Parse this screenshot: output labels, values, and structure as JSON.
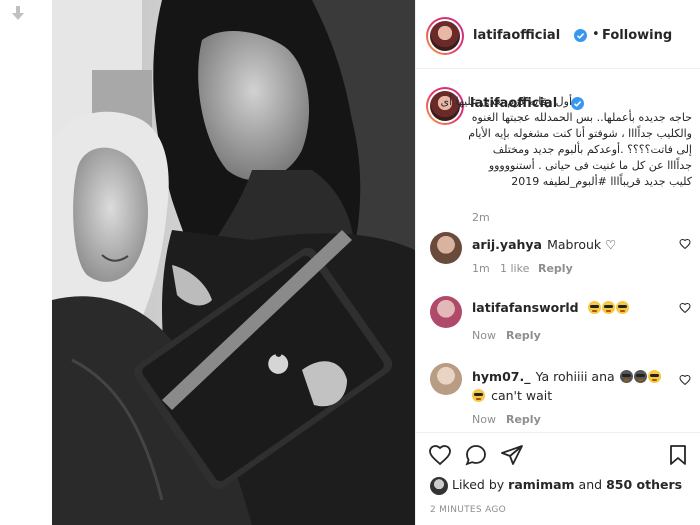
{
  "header": {
    "username": "latifaofficial",
    "separator": "•",
    "follow_status": "Following"
  },
  "caption": {
    "username": "latifaofficial",
    "lines": [
      "أول رقابه لازم يعدى عليها أى",
      "حاجه جديده بأعملها.. بس الحمدلله عجبتها الغنوه",
      "والكليب جداًااا ، شوفتو أنا كنت مشغوله بإيه الأيام",
      "إلى فاتت؟؟؟؟ .أوعدكم بألبوم جديد ومختلف",
      "جداًااا عن كل ما غنيت فى حياتى . أستنووووو",
      "كليب جديد قريباًااا #ألبوم_لطيفه 2019"
    ],
    "time": "2m"
  },
  "comments": [
    {
      "user": "arij.yahya",
      "text": "Mabrouk ♡",
      "time": "1m",
      "likes": "1 like",
      "reply": "Reply"
    },
    {
      "user": "latifafansworld",
      "text": "",
      "emoji_count": 3,
      "time": "Now",
      "reply": "Reply"
    },
    {
      "user": "hym07._",
      "text": "Ya rohiiii ana",
      "text2": "can't wait",
      "time": "Now",
      "reply": "Reply"
    }
  ],
  "actions": {
    "liked_prefix": "Liked by",
    "liked_user": "ramimam",
    "liked_and": "and",
    "liked_count": "850 others",
    "time_ago": "2 MINUTES AGO"
  },
  "icons": {
    "heart": "heart-icon",
    "comment": "comment-icon",
    "share": "share-icon",
    "save": "bookmark-icon",
    "verified": "verified-badge-icon",
    "download": "download-arrow-icon"
  },
  "colors": {
    "text": "#262626",
    "muted": "#8e8e8e",
    "verified": "#3897f0",
    "border": "#efefef"
  }
}
